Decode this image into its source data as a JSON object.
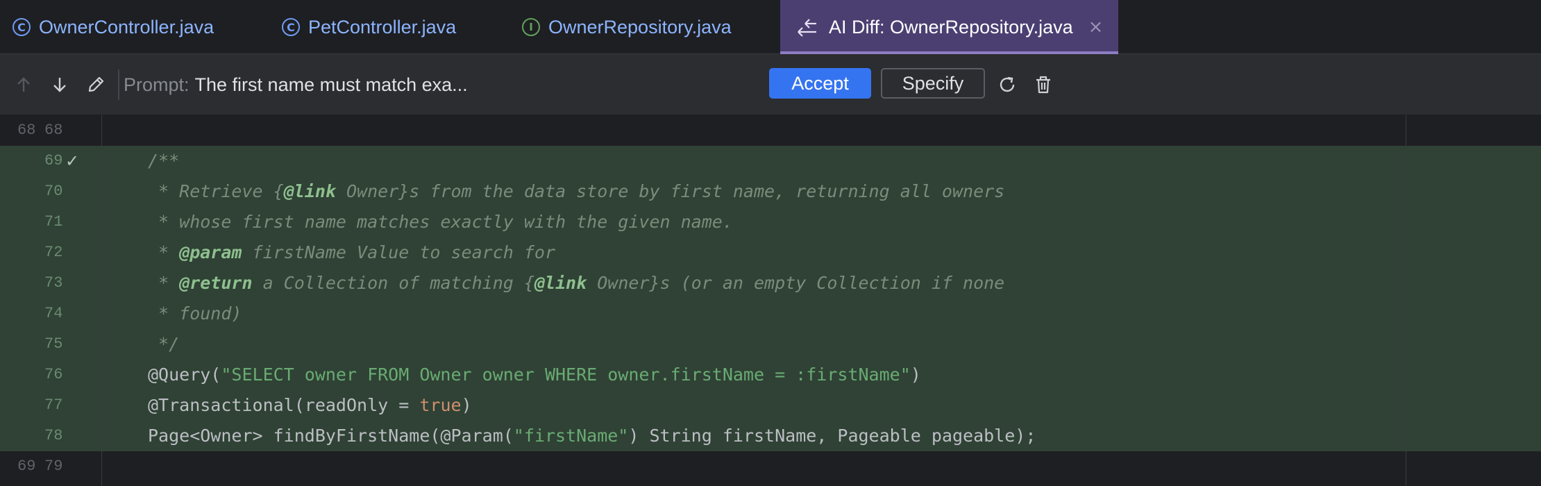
{
  "tabs": [
    {
      "label": "OwnerController.java",
      "icon": "class-icon",
      "glyph": "C"
    },
    {
      "label": "PetController.java",
      "icon": "class-icon",
      "glyph": "C"
    },
    {
      "label": "OwnerRepository.java",
      "icon": "interface-icon",
      "glyph": "I"
    },
    {
      "label": "AI Diff: OwnerRepository.java",
      "icon": "diff-icon",
      "close": "×"
    }
  ],
  "toolbar": {
    "prompt_label": "Prompt:",
    "prompt_text": "The first name must match exa...",
    "accept_label": "Accept",
    "specify_label": "Specify"
  },
  "editor": {
    "lines": [
      {
        "old": "68",
        "new": "68",
        "type": "context",
        "code": ""
      },
      {
        "old": "",
        "new": "69",
        "type": "added",
        "check": "✓",
        "code": "/**"
      },
      {
        "old": "",
        "new": "70",
        "type": "added",
        "code_parts": [
          " * Retrieve {",
          "@link",
          " Owner}s from the data store by first name, returning all owners"
        ]
      },
      {
        "old": "",
        "new": "71",
        "type": "added",
        "code": " * whose first name matches exactly with the given name."
      },
      {
        "old": "",
        "new": "72",
        "type": "added",
        "code_parts": [
          " * ",
          "@param",
          " firstName Value to search for"
        ]
      },
      {
        "old": "",
        "new": "73",
        "type": "added",
        "code_parts": [
          " * ",
          "@return",
          " a Collection of matching {",
          "@link",
          " Owner}s (or an empty Collection if none"
        ]
      },
      {
        "old": "",
        "new": "74",
        "type": "added",
        "code": " * found)"
      },
      {
        "old": "",
        "new": "75",
        "type": "added",
        "code": " */"
      },
      {
        "old": "",
        "new": "76",
        "type": "added",
        "code_parts": [
          "@Query(",
          "\"SELECT owner FROM Owner owner WHERE owner.firstName = :firstName\"",
          ")"
        ]
      },
      {
        "old": "",
        "new": "77",
        "type": "added",
        "code_parts": [
          "@Transactional(readOnly = ",
          "true",
          ")"
        ]
      },
      {
        "old": "",
        "new": "78",
        "type": "added",
        "code_parts": [
          "Page<Owner> findByFirstName(@Param(",
          "\"firstName\"",
          ") String firstName, Pageable pageable);"
        ]
      },
      {
        "old": "69",
        "new": "79",
        "type": "context",
        "code": ""
      }
    ]
  },
  "colors": {
    "accent": "#3574f0",
    "active_tab": "#4b3f72",
    "added_line": "#2f4235"
  }
}
